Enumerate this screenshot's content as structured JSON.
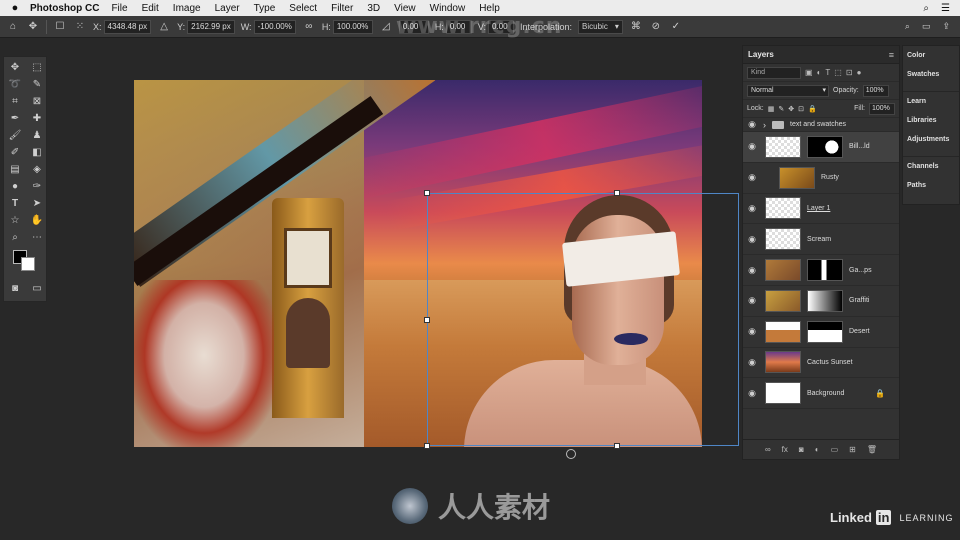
{
  "menubar": {
    "app": "Photoshop CC",
    "items": [
      "File",
      "Edit",
      "Image",
      "Layer",
      "Type",
      "Select",
      "Filter",
      "3D",
      "View",
      "Window",
      "Help"
    ]
  },
  "options": {
    "x_label": "X:",
    "x_value": "4348.48 px",
    "y_label": "Y:",
    "y_value": "2162.99 px",
    "w_label": "W:",
    "w_value": "-100.00%",
    "h_label": "H:",
    "h_value": "100.00%",
    "angle_value": "0.00",
    "h_skew_label": "H:",
    "h_skew_value": "0.00",
    "v_skew_label": "V:",
    "v_skew_value": "0.00",
    "interpolation_label": "Interpolation:",
    "interpolation_value": "Bicubic"
  },
  "watermark": {
    "top": "www.rrcg.cn",
    "bottom": "人人素材"
  },
  "branding": {
    "linked": "Linked",
    "in": "in",
    "learning": "LEARNING"
  },
  "layers_panel": {
    "title": "Layers",
    "kind_placeholder": "Kind",
    "blend_mode": "Normal",
    "opacity_label": "Opacity:",
    "opacity_value": "100%",
    "lock_label": "Lock:",
    "fill_label": "Fill:",
    "fill_value": "100%",
    "layers": [
      {
        "name": "text and swatches",
        "type": "group"
      },
      {
        "name": "Bill...ld",
        "type": "layer"
      },
      {
        "name": "Rusty",
        "type": "layer"
      },
      {
        "name": "Layer 1",
        "type": "layer"
      },
      {
        "name": "Scream",
        "type": "layer"
      },
      {
        "name": "Ga...ps",
        "type": "layer"
      },
      {
        "name": "Graffiti",
        "type": "layer"
      },
      {
        "name": "Desert",
        "type": "layer"
      },
      {
        "name": "Cactus Sunset",
        "type": "layer"
      },
      {
        "name": "Background",
        "type": "background"
      }
    ]
  },
  "dock": {
    "items": [
      "Color",
      "Swatches",
      "Learn",
      "Libraries",
      "Adjustments",
      "Channels",
      "Paths"
    ]
  }
}
